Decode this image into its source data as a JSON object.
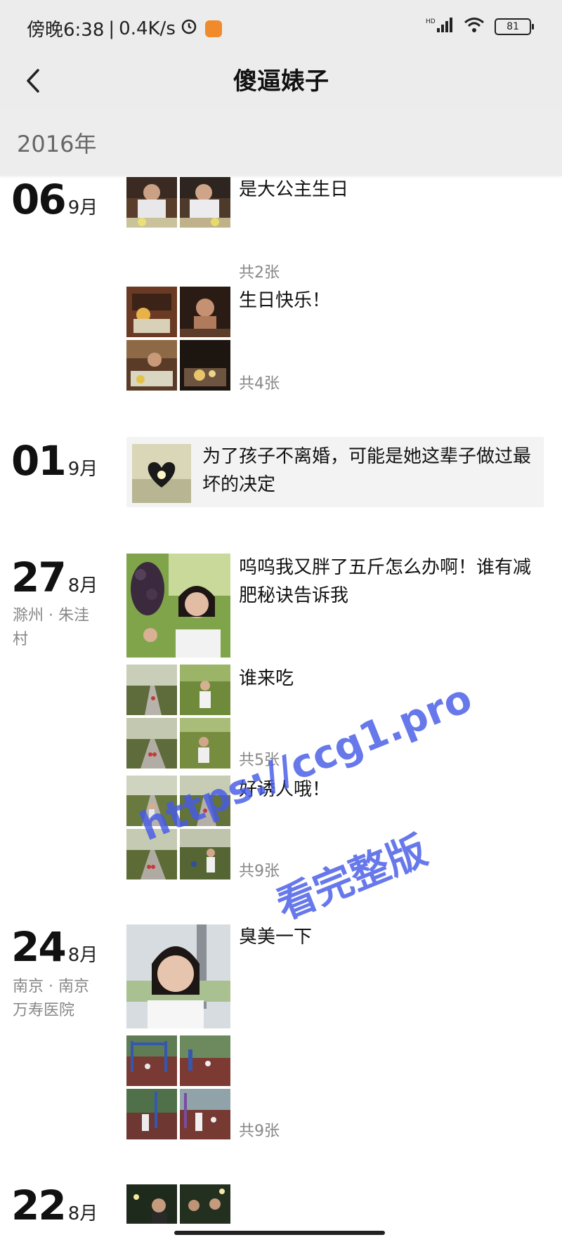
{
  "status": {
    "time": "傍晚6:38",
    "speed": "0.4K/s",
    "battery": "81"
  },
  "header": {
    "title": "傻逼婊子"
  },
  "year": "2016年",
  "entries": [
    {
      "day": "06",
      "month": "9月"
    },
    {
      "day": "01",
      "month": "9月"
    },
    {
      "day": "27",
      "month": "8月",
      "location": "滁州 · 朱洼村"
    },
    {
      "day": "24",
      "month": "8月",
      "location": "南京 · 南京万寿医院"
    },
    {
      "day": "22",
      "month": "8月"
    }
  ],
  "posts": [
    {
      "text": "是大公主生日",
      "count": "共2张"
    },
    {
      "text": "生日快乐！",
      "count": "共4张"
    },
    {
      "text": "为了孩子不离婚，可能是她这辈子做过最坏的决定"
    },
    {
      "text": "呜呜我又胖了五斤怎么办啊！谁有减肥秘诀告诉我"
    },
    {
      "text": "谁来吃",
      "count": "共5张"
    },
    {
      "text": "好诱人哦！",
      "count": "共9张"
    },
    {
      "text": "臭美一下"
    },
    {
      "count": "共9张"
    }
  ],
  "watermark": {
    "url": "https://ccg1.pro",
    "label": "看完整版"
  },
  "colors": {
    "bar_bg": "#ececec",
    "year_bg": "#ededed",
    "watermark": "#4a5ae6"
  }
}
